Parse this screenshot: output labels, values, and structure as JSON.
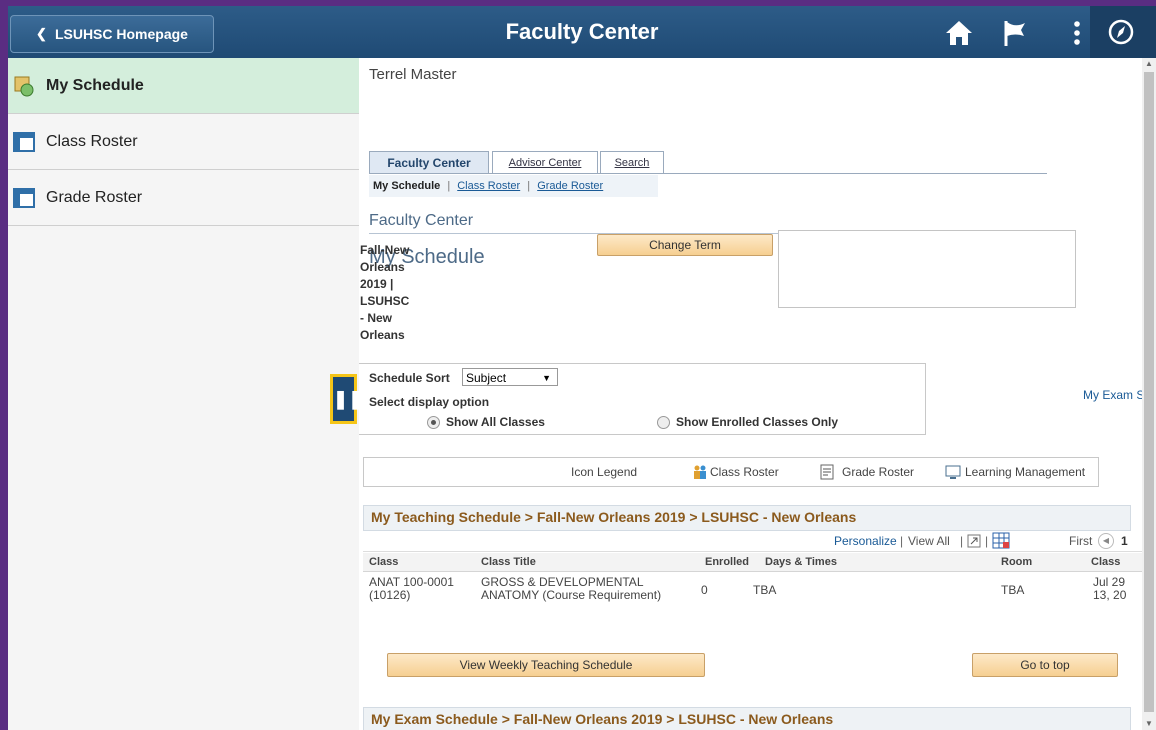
{
  "header": {
    "back_label": "LSUHSC Homepage",
    "title": "Faculty Center"
  },
  "sidebar": {
    "items": [
      {
        "label": "My Schedule"
      },
      {
        "label": "Class Roster"
      },
      {
        "label": "Grade Roster"
      }
    ]
  },
  "main": {
    "user_name": "Terrel Master",
    "tabs": [
      {
        "label": "Faculty Center"
      },
      {
        "label": "Advisor Center"
      },
      {
        "label": "Search"
      }
    ],
    "subnav": {
      "current": "My Schedule",
      "sep": "|",
      "class_roster": "Class Roster",
      "grade_roster": "Grade Roster"
    },
    "section_title": "Faculty Center",
    "page_title": "My Schedule",
    "term_lines": [
      "Fall-New",
      "Orleans",
      "2019 |",
      "LSUHSC",
      "- New",
      "Orleans"
    ],
    "change_term_label": "Change Term",
    "sort": {
      "label": "Schedule Sort",
      "value": "Subject"
    },
    "display_option_label": "Select display option",
    "radio_all": "Show All Classes",
    "radio_enrolled": "Show Enrolled Classes Only",
    "my_exam_link": "My Exam S",
    "legend": {
      "title": "Icon Legend",
      "class_roster": "Class Roster",
      "grade_roster": "Grade Roster",
      "learning": "Learning Management"
    },
    "teaching": {
      "header": "My Teaching Schedule > Fall-New Orleans 2019 > LSUHSC - New Orleans",
      "personalize": "Personalize",
      "view_all": "View All",
      "first": "First",
      "page": "1",
      "columns": [
        "Class",
        "Class Title",
        "Enrolled",
        "Days & Times",
        "Room",
        "Class"
      ],
      "row": {
        "class_line1": "ANAT 100-0001",
        "class_line2": "(10126)",
        "title_line1": "GROSS & DEVELOPMENTAL",
        "title_line2": "ANATOMY (Course Requirement)",
        "enrolled": "0",
        "days": "TBA",
        "room": "TBA",
        "dates_line1": "Jul 29",
        "dates_line2": "13, 20"
      }
    },
    "weekly_button": "View Weekly Teaching Schedule",
    "top_button": "Go to top",
    "exam_header": "My Exam Schedule > Fall-New Orleans 2019 > LSUHSC - New Orleans"
  }
}
